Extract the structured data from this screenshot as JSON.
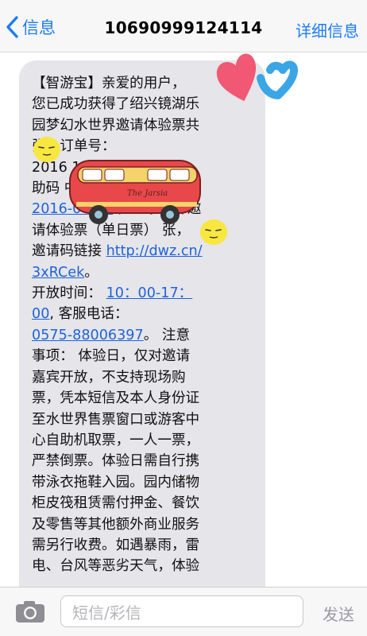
{
  "nav": {
    "back_label": "信息",
    "title": "10690999124114",
    "details_label": "详细信息"
  },
  "message": {
    "lines": [
      {
        "parts": [
          {
            "t": "【智游宝】亲爱的用户，"
          }
        ]
      },
      {
        "parts": [
          {
            "t": "您已成功获得了绍兴镜湖乐"
          }
        ]
      },
      {
        "parts": [
          {
            "t": "园梦幻水世界邀请体验票共"
          }
        ]
      },
      {
        "parts": [
          {
            "t": "  张。订单号："
          }
        ]
      },
      {
        "parts": [
          {
            "t": "2016               16687 辅"
          }
        ]
      },
      {
        "parts": [
          {
            "t": "助码               中："
          }
        ]
      },
      {
        "parts": [
          {
            "t": "2016-06-10",
            "link": true
          },
          {
            "t": " 梦幻水世界邀"
          }
        ]
      },
      {
        "parts": [
          {
            "t": "请体验票（单日票）  张，"
          }
        ]
      },
      {
        "parts": [
          {
            "t": "邀请码链接 "
          },
          {
            "t": "http://dwz.cn/",
            "link": true
          }
        ]
      },
      {
        "parts": [
          {
            "t": "3xRCek",
            "link": true
          },
          {
            "t": "。"
          }
        ]
      },
      {
        "parts": [
          {
            "t": " 开放时间： "
          },
          {
            "t": "10：00-17：",
            "link": true
          }
        ]
      },
      {
        "parts": [
          {
            "t": "00",
            "link": true
          },
          {
            "t": ", 客服电话："
          }
        ]
      },
      {
        "parts": [
          {
            "t": "0575-88006397",
            "link": true
          },
          {
            "t": "。 注意"
          }
        ]
      },
      {
        "parts": [
          {
            "t": "事项： 体验日，仅对邀请"
          }
        ]
      },
      {
        "parts": [
          {
            "t": "嘉宾开放，不支持现场购"
          }
        ]
      },
      {
        "parts": [
          {
            "t": "票，凭本短信及本人身份证"
          }
        ]
      },
      {
        "parts": [
          {
            "t": "至水世界售票窗口或游客中"
          }
        ]
      },
      {
        "parts": [
          {
            "t": "心自助机取票，一人一票，"
          }
        ]
      },
      {
        "parts": [
          {
            "t": "严禁倒票。体验日需自行携"
          }
        ]
      },
      {
        "parts": [
          {
            "t": "带泳衣拖鞋入园。园内储物"
          }
        ]
      },
      {
        "parts": [
          {
            "t": "柜皮筏租赁需付押金、餐饮"
          }
        ]
      },
      {
        "parts": [
          {
            "t": "及零售等其他额外商业服务"
          }
        ]
      },
      {
        "parts": [
          {
            "t": "需另行收费。如遇暴雨，雷"
          }
        ]
      },
      {
        "parts": [
          {
            "t": "电、台风等恶劣天气，体验"
          }
        ]
      }
    ]
  },
  "stickers": {
    "bus_label": "The Jarsia"
  },
  "input": {
    "placeholder": "短信/彩信",
    "send_label": "发送"
  },
  "colors": {
    "accent": "#1c7cf4",
    "bubble": "#e5e5ea",
    "link": "#1f63d8",
    "heart": "#f0506e",
    "heart2": "#3aa6e6"
  }
}
